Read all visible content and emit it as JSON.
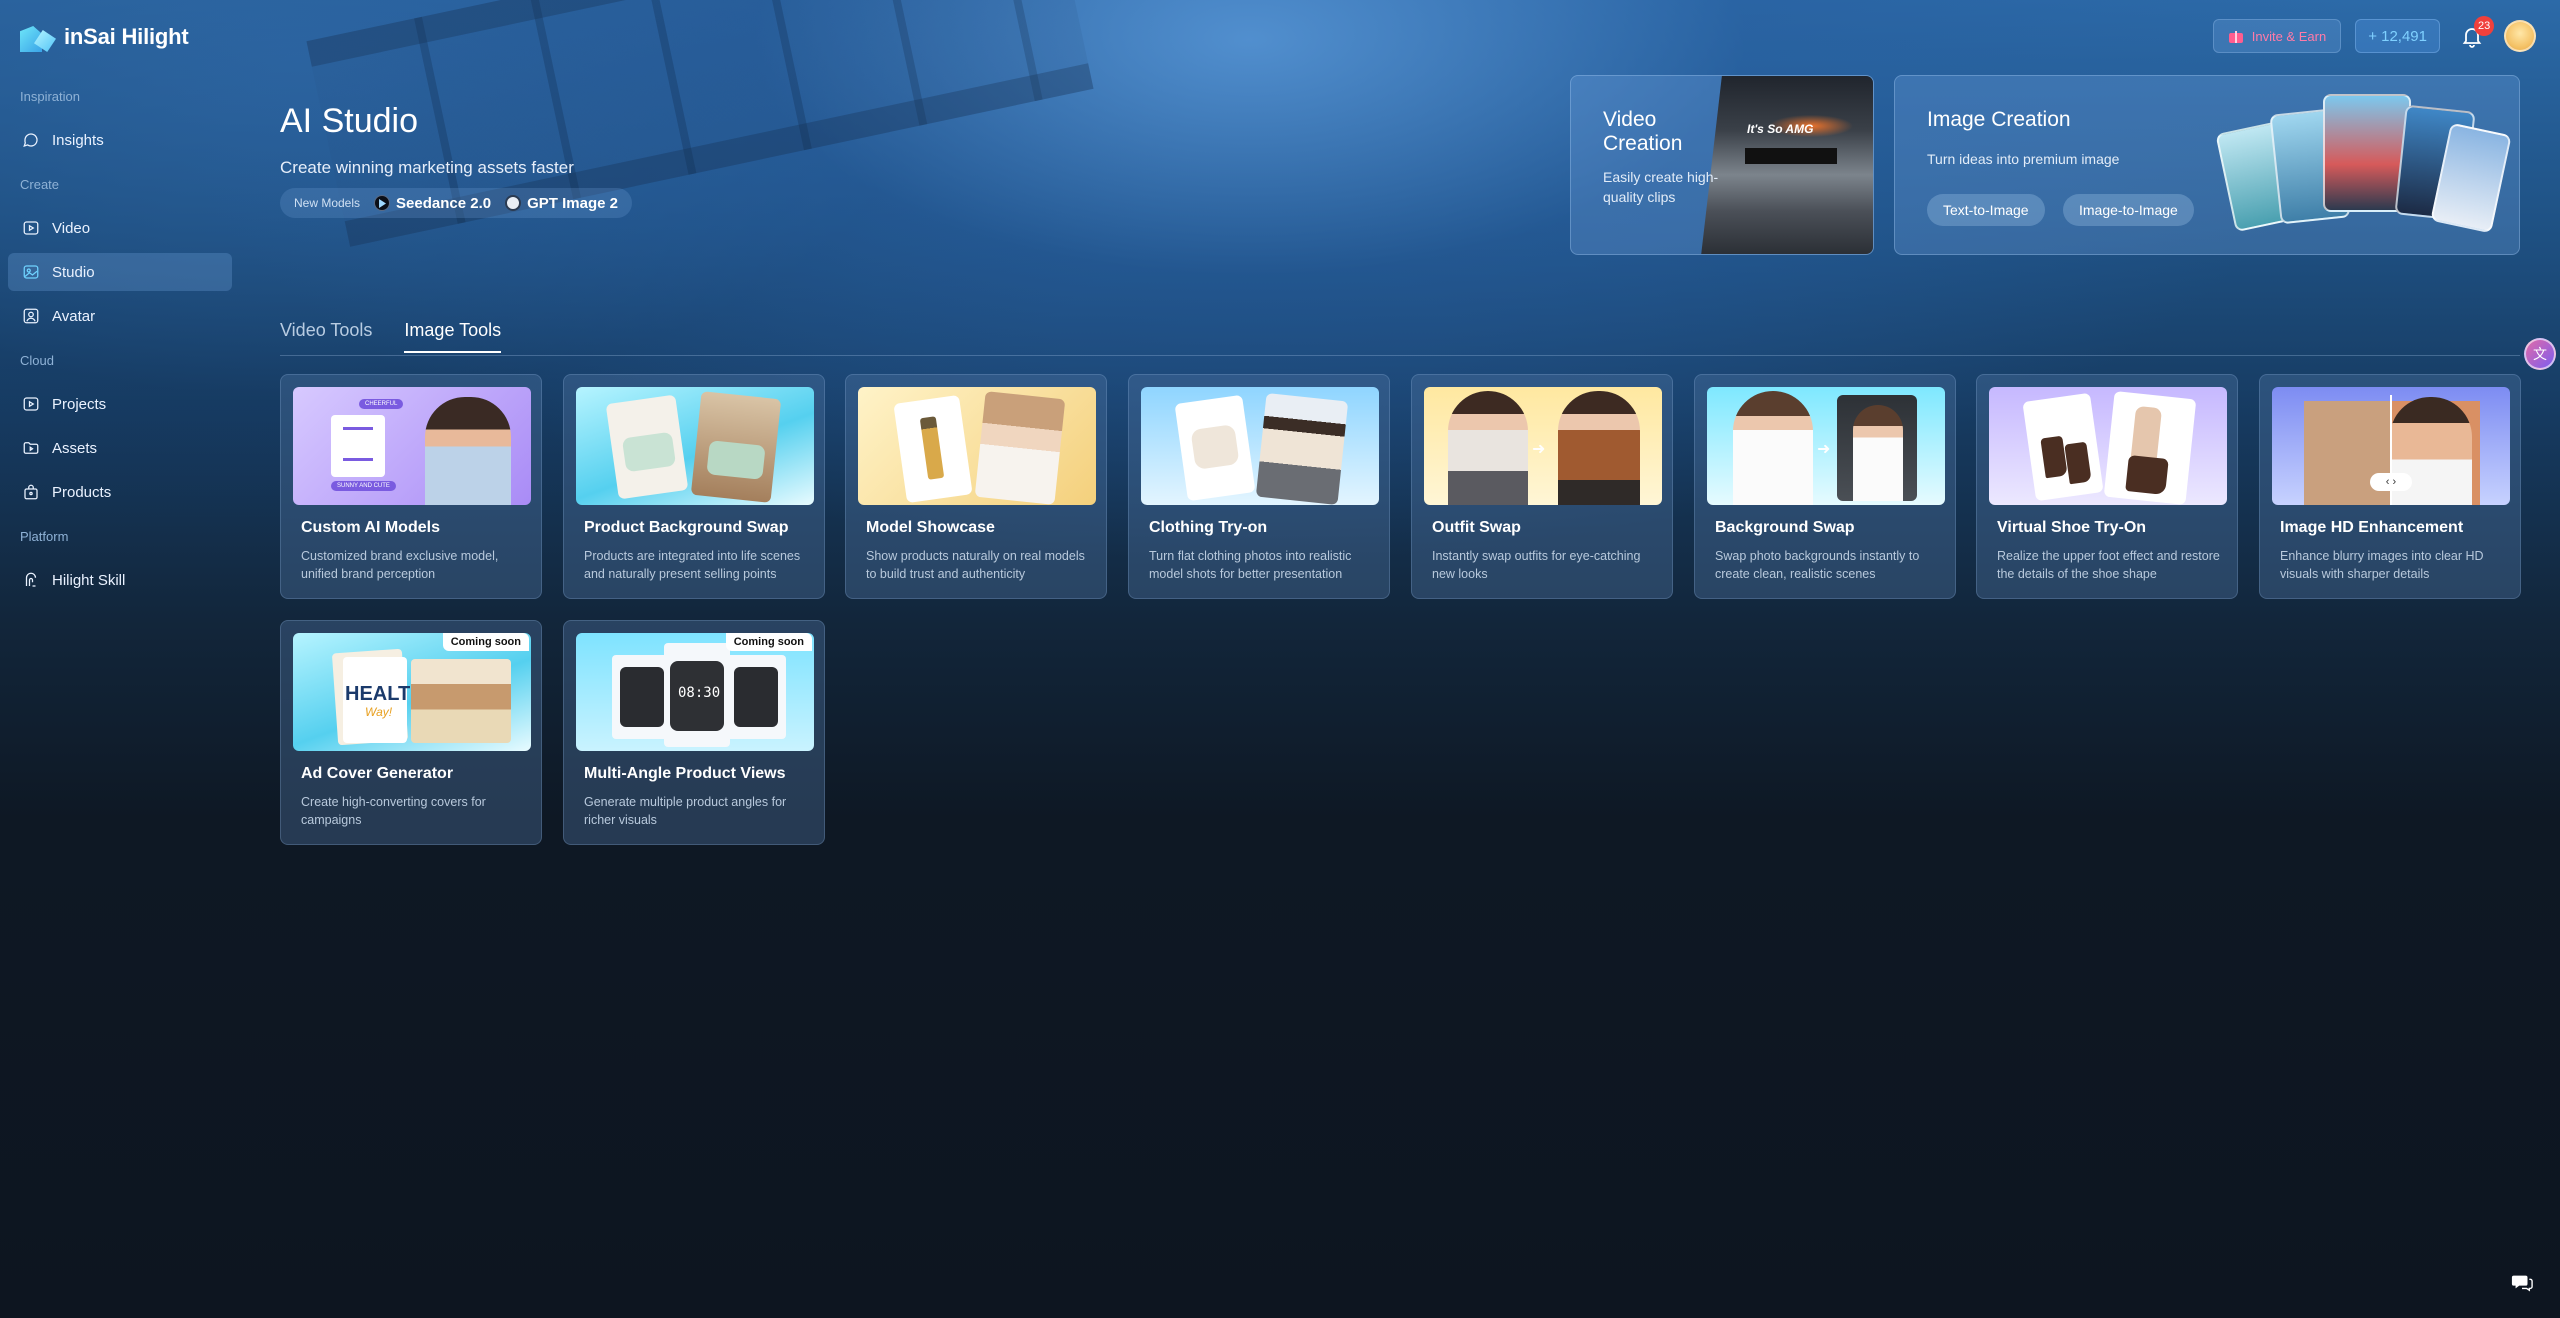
{
  "app": {
    "name": "inSai Hilight"
  },
  "sidebar": {
    "sections": [
      {
        "label": "Inspiration"
      },
      {
        "label": "Create"
      },
      {
        "label": "Cloud"
      },
      {
        "label": "Platform"
      }
    ],
    "items": [
      {
        "label": "Insights",
        "icon": "chat-bubble-icon"
      },
      {
        "label": "Video",
        "icon": "video-icon"
      },
      {
        "label": "Studio",
        "icon": "image-icon",
        "active": true
      },
      {
        "label": "Avatar",
        "icon": "avatar-icon"
      },
      {
        "label": "Projects",
        "icon": "projects-icon"
      },
      {
        "label": "Assets",
        "icon": "folder-icon"
      },
      {
        "label": "Products",
        "icon": "bag-icon"
      },
      {
        "label": "Hilight Skill",
        "icon": "skill-icon"
      }
    ]
  },
  "topbar": {
    "invite_label": "Invite & Earn",
    "credits_label": "+ 12,491",
    "notification_count": "23"
  },
  "hero": {
    "title": "AI Studio",
    "subtitle": "Create winning marketing assets faster",
    "new_models_label": "New Models",
    "models": [
      "Seedance 2.0",
      "GPT Image 2"
    ]
  },
  "features": {
    "video": {
      "title": "Video Creation",
      "desc": "Easily create high-quality clips",
      "sign_text": "It's So AMG"
    },
    "image": {
      "title": "Image Creation",
      "desc": "Turn ideas into premium image",
      "buttons": [
        "Text-to-Image",
        "Image-to-Image"
      ]
    }
  },
  "tabs": [
    {
      "label": "Video Tools",
      "active": false
    },
    {
      "label": "Image Tools",
      "active": true
    }
  ],
  "tools": [
    {
      "name": "Custom AI Models",
      "desc": "Customized brand exclusive model, unified brand perception",
      "coming_soon": false
    },
    {
      "name": "Product Background Swap",
      "desc": "Products are integrated into life scenes and naturally present selling points",
      "coming_soon": false
    },
    {
      "name": "Model Showcase",
      "desc": "Show products naturally on real models to build trust and authenticity",
      "coming_soon": false
    },
    {
      "name": "Clothing Try-on",
      "desc": "Turn flat clothing photos into realistic model shots for better presentation",
      "coming_soon": false
    },
    {
      "name": "Outfit Swap",
      "desc": "Instantly swap outfits for eye-catching new looks",
      "coming_soon": false
    },
    {
      "name": "Background Swap",
      "desc": "Swap photo backgrounds instantly to create clean, realistic scenes",
      "coming_soon": false
    },
    {
      "name": "Virtual Shoe Try-On",
      "desc": "Realize the upper foot effect and restore the details of the shoe shape",
      "coming_soon": false
    },
    {
      "name": "Image HD Enhancement",
      "desc": "Enhance blurry images into clear HD visuals with sharper details",
      "coming_soon": false
    },
    {
      "name": "Ad Cover Generator",
      "desc": "Create high-converting covers for campaigns",
      "coming_soon": true
    },
    {
      "name": "Multi-Angle Product Views",
      "desc": "Generate multiple product angles for richer visuals",
      "coming_soon": true
    }
  ],
  "labels": {
    "coming_soon": "Coming soon"
  },
  "thumb_text": {
    "custom_models_tags": [
      "CHEERFUL",
      "SUNNY AND CUTE"
    ],
    "ad_cover": [
      "HEALTHY",
      "Way!"
    ],
    "clock": "08:30"
  }
}
